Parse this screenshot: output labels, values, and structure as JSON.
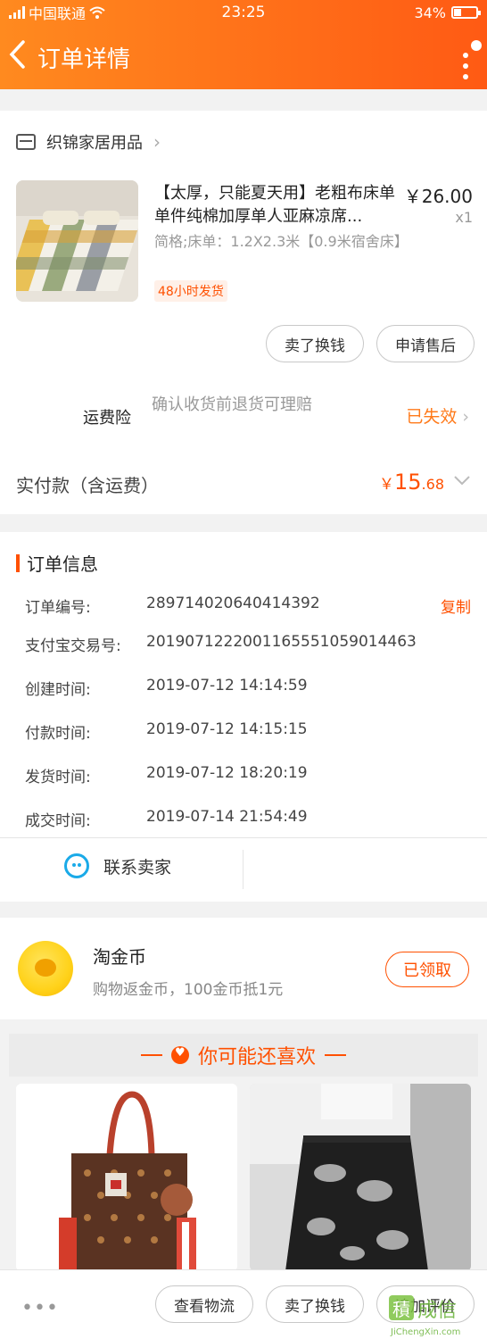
{
  "status_bar": {
    "carrier": "中国联通",
    "time": "23:25",
    "battery": "34%"
  },
  "header": {
    "title": "订单详情"
  },
  "shop": {
    "name": "织锦家居用品"
  },
  "product": {
    "title": "【太厚，只能夏天用】老粗布床单单件纯棉加厚单人亚麻凉席...",
    "price": "￥26.00",
    "qty": "x1",
    "spec": "简格;床单：1.2X2.3米【0.9米宿舍床】",
    "tag": "48小时发货"
  },
  "item_actions": {
    "exchange": "卖了换钱",
    "after_sale": "申请售后"
  },
  "insurance": {
    "label": "运费险",
    "desc": "确认收货前退货可理赔",
    "status": "已失效"
  },
  "payment": {
    "label": "实付款（含运费）",
    "currency": "￥",
    "integer": "15",
    "decimal": ".68"
  },
  "order_info": {
    "title": "订单信息",
    "copy_label": "复制",
    "rows": [
      {
        "label": "订单编号:",
        "value": "289714020640414392"
      },
      {
        "label": "支付宝交易号:",
        "value": "2019071222001165551059014463"
      },
      {
        "label": "创建时间:",
        "value": "2019-07-12 14:14:59"
      },
      {
        "label": "付款时间:",
        "value": "2019-07-12 14:15:15"
      },
      {
        "label": "发货时间:",
        "value": "2019-07-12 18:20:19"
      },
      {
        "label": "成交时间:",
        "value": "2019-07-14 21:54:49"
      }
    ],
    "contact": "联系卖家"
  },
  "coin": {
    "title": "淘金币",
    "subtitle": "购物返金币，100金币抵1元",
    "button": "已领取"
  },
  "recommend": {
    "title": "你可能还喜欢"
  },
  "bottom_bar": {
    "more": "•••",
    "logistics": "查看物流",
    "exchange": "卖了换钱",
    "review": "追加评价"
  },
  "watermark": {
    "text": "积成信",
    "url": "JiChengXin.com"
  },
  "colors": {
    "accent": "#ff5000",
    "header_start": "#ff8a1f",
    "header_end": "#ff5a14"
  }
}
